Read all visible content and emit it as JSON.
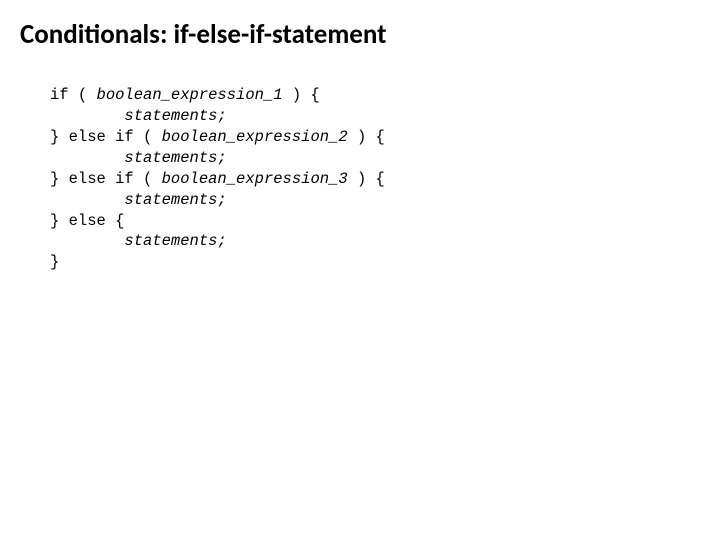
{
  "title": "Conditionals: if-else-if-statement",
  "code": {
    "l1a": "if ( ",
    "l1b": "boolean_expression_1",
    "l1c": " ) {",
    "l2a": "        ",
    "l2b": "statements;",
    "l3a": "} else if ( ",
    "l3b": "boolean_expression_2",
    "l3c": " ) {",
    "l4a": "        ",
    "l4b": "statements;",
    "l5a": "} else if ( ",
    "l5b": "boolean_expression_3",
    "l5c": " ) {",
    "l6a": "        ",
    "l6b": "statements;",
    "l7": "} else {",
    "l8a": "        ",
    "l8b": "statements;",
    "l9": "}"
  }
}
